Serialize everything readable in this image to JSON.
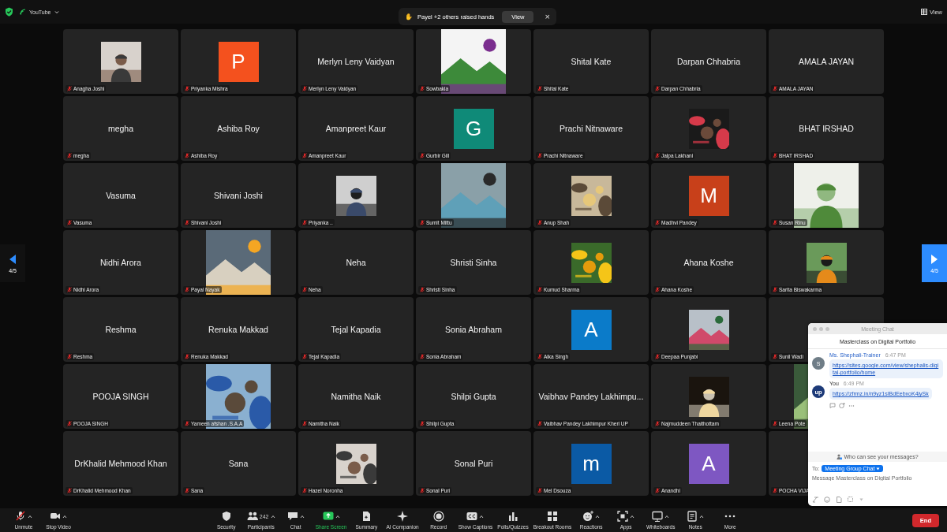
{
  "top_bar": {
    "app": "YouTube",
    "view_label": "View"
  },
  "raise_hand_toast": {
    "icon": "✋",
    "message": "Payel +2 others raised hands",
    "button": "View",
    "close": "×"
  },
  "page_nav": [
    {
      "label": "4/5",
      "highlighted": false
    },
    {
      "label": "4/5",
      "highlighted": true
    }
  ],
  "tiles": [
    {
      "kind": "picture",
      "label": "Anagha Joshi"
    },
    {
      "kind": "letter",
      "letter": "P",
      "color": "#f4511e",
      "label": "Priyanka Mishra"
    },
    {
      "kind": "name",
      "display": "Merlyn Leny Vaidyan",
      "label": "Merlyn Leny Vaidyan"
    },
    {
      "kind": "picture-full",
      "label": "Sowbakia"
    },
    {
      "kind": "name",
      "display": "Shital Kate",
      "label": "Shital Kate"
    },
    {
      "kind": "name",
      "display": "Darpan Chhabria",
      "label": "Darpan Chhabria"
    },
    {
      "kind": "name",
      "display": "AMALA JAYAN",
      "label": "AMALA JAYAN"
    },
    {
      "kind": "name",
      "display": "megha",
      "label": "megha"
    },
    {
      "kind": "name",
      "display": "Ashiba Roy",
      "label": "Ashiba Roy"
    },
    {
      "kind": "name",
      "display": "Amanpreet Kaur",
      "label": "Amanpreet Kaur"
    },
    {
      "kind": "letter",
      "letter": "G",
      "color": "#0f8a78",
      "label": "Gurbir Gill"
    },
    {
      "kind": "name",
      "display": "Prachi Nitnaware",
      "label": "Prachi Nitnaware"
    },
    {
      "kind": "picture",
      "label": "Jalpa Lakhani"
    },
    {
      "kind": "name",
      "display": "BHAT IRSHAD",
      "label": "BHAT IRSHAD"
    },
    {
      "kind": "name",
      "display": "Vasuma",
      "label": "Vasuma"
    },
    {
      "kind": "name",
      "display": "Shivani Joshi",
      "label": "Shivani Joshi"
    },
    {
      "kind": "picture",
      "label": "Priyanka .."
    },
    {
      "kind": "picture-full",
      "label": "Sumit Mittu"
    },
    {
      "kind": "picture",
      "label": "Anup Shah"
    },
    {
      "kind": "letter",
      "letter": "M",
      "color": "#c8401a",
      "label": "Madhvi Pandey"
    },
    {
      "kind": "picture-full",
      "label": "Susan Rinu"
    },
    {
      "kind": "name",
      "display": "Nidhi Arora",
      "label": "Nidhi Arora"
    },
    {
      "kind": "picture-full",
      "label": "Payal Nayak"
    },
    {
      "kind": "name",
      "display": "Neha",
      "label": "Neha"
    },
    {
      "kind": "name",
      "display": "Shristi Sinha",
      "label": "Shristi Sinha"
    },
    {
      "kind": "picture",
      "label": "Kumud Sharma"
    },
    {
      "kind": "name",
      "display": "Ahana Koshe",
      "label": "Ahana Koshe"
    },
    {
      "kind": "picture",
      "label": "Sarita Biswakarma"
    },
    {
      "kind": "name",
      "display": "Reshma",
      "label": "Reshma"
    },
    {
      "kind": "name",
      "display": "Renuka Makkad",
      "label": "Renuka Makkad"
    },
    {
      "kind": "name",
      "display": "Tejal Kapadia",
      "label": "Tejal Kapadia"
    },
    {
      "kind": "name",
      "display": "Sonia Abraham",
      "label": "Sonia Abraham"
    },
    {
      "kind": "letter",
      "letter": "A",
      "color": "#0b7bc9",
      "label": "Alka Singh"
    },
    {
      "kind": "picture",
      "label": "Deepaa Punjabi"
    },
    {
      "kind": "blank",
      "label": "Sunil Wadi"
    },
    {
      "kind": "name",
      "display": "POOJA SINGH",
      "label": "POOJA SINGH"
    },
    {
      "kind": "picture-full",
      "label": "Yameen afshan .S.A.A"
    },
    {
      "kind": "name",
      "display": "Namitha Naik",
      "label": "Namitha Naik"
    },
    {
      "kind": "name",
      "display": "Shilpi Gupta",
      "label": "Shilpi Gupta"
    },
    {
      "kind": "name",
      "display": "Vaibhav Pandey Lakhimpu...",
      "label": "Vaibhav Pandey Lakhimpur Kheri UP"
    },
    {
      "kind": "picture",
      "label": "Najmuddeen Thaithottam"
    },
    {
      "kind": "picture-full",
      "label": "Leena Pote"
    },
    {
      "kind": "name",
      "display": "DrKhalid Mehmood Khan",
      "label": "DrKhalid Mehmood Khan"
    },
    {
      "kind": "name",
      "display": "Sana",
      "label": "Sana"
    },
    {
      "kind": "picture",
      "label": "Hazel Noronha"
    },
    {
      "kind": "name",
      "display": "Sonal Puri",
      "label": "Sonal Puri"
    },
    {
      "kind": "letter",
      "letter": "m",
      "color": "#0b5aa5",
      "label": "Mel Dsouza"
    },
    {
      "kind": "letter",
      "letter": "A",
      "color": "#7e57c2",
      "label": "Anandhi"
    },
    {
      "kind": "blank",
      "label": "POCHA VIJA"
    }
  ],
  "chat": {
    "window_title": "Meeting Chat",
    "header": "Masterclass on Digital Portfolio",
    "messages": [
      {
        "sender": "Ms. Shephali-Trainer",
        "time": "6:47 PM",
        "avatar": "S",
        "link": "https://sites.google.com/view/shephalis-digital-portfolio/home",
        "reactions": false
      },
      {
        "sender": "You",
        "time": "6:49 PM",
        "avatar": "up",
        "link": "https://zfrmz.in/n9yz1sIBdEebxoK4jySk",
        "reactions": true
      }
    ],
    "privacy_link": "Who can see your messages?",
    "to_label": "To:",
    "recipient": "Meeting Group Chat",
    "placeholder": "Message Masterclass on Digital Portfolio"
  },
  "toolbar": {
    "left": [
      {
        "label": "Unmute",
        "caret": true,
        "active": false
      },
      {
        "label": "Stop Video",
        "caret": true,
        "active": false
      }
    ],
    "center": [
      {
        "label": "Security",
        "caret": false,
        "active": false
      },
      {
        "label": "Participants",
        "count": "242",
        "caret": true,
        "active": false
      },
      {
        "label": "Chat",
        "caret": true,
        "active": false
      },
      {
        "label": "Share Screen",
        "caret": true,
        "active": true
      },
      {
        "label": "Summary",
        "caret": false,
        "active": false
      },
      {
        "label": "AI Companion",
        "caret": false,
        "active": false
      },
      {
        "label": "Record",
        "caret": false,
        "active": false
      },
      {
        "label": "Show Captions",
        "caret": true,
        "active": false
      },
      {
        "label": "Polls/Quizzes",
        "caret": false,
        "active": false
      },
      {
        "label": "Breakout Rooms",
        "caret": false,
        "active": false
      },
      {
        "label": "Reactions",
        "caret": true,
        "active": false
      },
      {
        "label": "Apps",
        "caret": true,
        "active": false
      },
      {
        "label": "Whiteboards",
        "caret": true,
        "active": false
      },
      {
        "label": "Notes",
        "caret": true,
        "active": false
      },
      {
        "label": "More",
        "caret": false,
        "active": false
      }
    ],
    "end_button": "End"
  }
}
